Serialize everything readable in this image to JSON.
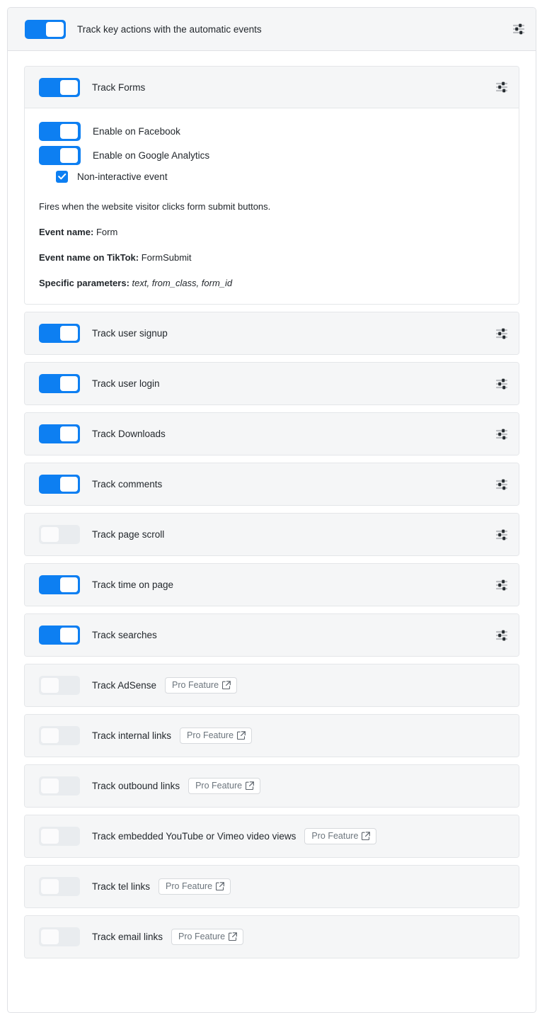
{
  "master": {
    "label": "Track key actions with the automatic events",
    "enabled": true,
    "settings_icon": "sliders-icon"
  },
  "theme": {
    "accent_on": "#0d7ff2",
    "track_off": "#e9ecef",
    "card_bg": "#f5f6f7",
    "card_border": "#e4e6e9",
    "text": "#23282d",
    "muted": "#6c757d"
  },
  "pro_badge": {
    "label": "Pro Feature",
    "icon": "external-link-icon"
  },
  "events": [
    {
      "id": "track-forms",
      "label": "Track Forms",
      "enabled": true,
      "expanded": true,
      "pro": false,
      "details": {
        "sub_toggles": [
          {
            "label": "Enable on Facebook",
            "enabled": true
          },
          {
            "label": "Enable on Google Analytics",
            "enabled": true
          }
        ],
        "checkbox": {
          "label": "Non-interactive event",
          "checked": true
        },
        "description": "Fires when the website visitor clicks form submit buttons.",
        "event_name_label": "Event name:",
        "event_name_value": "Form",
        "tiktok_label": "Event name on TikTok:",
        "tiktok_value": "FormSubmit",
        "params_label": "Specific parameters:",
        "params_value": "text, from_class, form_id"
      }
    },
    {
      "id": "track-user-signup",
      "label": "Track user signup",
      "enabled": true,
      "expanded": false,
      "pro": false
    },
    {
      "id": "track-user-login",
      "label": "Track user login",
      "enabled": true,
      "expanded": false,
      "pro": false
    },
    {
      "id": "track-downloads",
      "label": "Track Downloads",
      "enabled": true,
      "expanded": false,
      "pro": false
    },
    {
      "id": "track-comments",
      "label": "Track comments",
      "enabled": true,
      "expanded": false,
      "pro": false
    },
    {
      "id": "track-page-scroll",
      "label": "Track page scroll",
      "enabled": false,
      "expanded": false,
      "pro": false
    },
    {
      "id": "track-time-on-page",
      "label": "Track time on page",
      "enabled": true,
      "expanded": false,
      "pro": false
    },
    {
      "id": "track-searches",
      "label": "Track searches",
      "enabled": true,
      "expanded": false,
      "pro": false
    },
    {
      "id": "track-adsense",
      "label": "Track AdSense",
      "enabled": false,
      "expanded": false,
      "pro": true
    },
    {
      "id": "track-internal-links",
      "label": "Track internal links",
      "enabled": false,
      "expanded": false,
      "pro": true
    },
    {
      "id": "track-outbound-links",
      "label": "Track outbound links",
      "enabled": false,
      "expanded": false,
      "pro": true
    },
    {
      "id": "track-embedded-video-views",
      "label": "Track embedded YouTube or Vimeo video views",
      "enabled": false,
      "expanded": false,
      "pro": true
    },
    {
      "id": "track-tel-links",
      "label": "Track tel links",
      "enabled": false,
      "expanded": false,
      "pro": true
    },
    {
      "id": "track-email-links",
      "label": "Track email links",
      "enabled": false,
      "expanded": false,
      "pro": true
    }
  ]
}
